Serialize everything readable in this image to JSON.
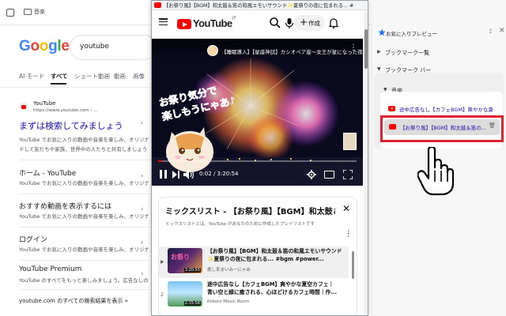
{
  "google": {
    "topbar_label": "音楽",
    "search_value": "youtube",
    "tabs": [
      "AI モード",
      "すべて",
      "ショート動画",
      "動画",
      "画像"
    ],
    "result": {
      "site_name": "YouTube",
      "url": "https://www.youtube.com › ...",
      "title": "まずは検索してみましょう",
      "snippet1": "YouTube でお気に入りの動画や音楽を楽しみ、オリジナ",
      "snippet2": "ドして友だちや家族、世界中の人たちと共有しましょう"
    },
    "subresults": [
      {
        "title": "ホーム - YouTube",
        "snippet": "YouTube でお気に入りの動画や音楽を楽しみ、オリジナ"
      },
      {
        "title": "おすすめ動画を表示するには",
        "snippet": "YouTube でお気に入りの動画や音楽を楽しみ、オリジナ"
      },
      {
        "title": "ログイン",
        "snippet": "YouTube でお気に入りの動画や音楽を楽しみ、オリジナ"
      },
      {
        "title": "YouTube Premium",
        "snippet": "YouTube のすべてをもっと楽しみましょう。広告なしの"
      }
    ],
    "more_results": "youtube.com のすべての検索結果を表示 »"
  },
  "youtube": {
    "window_title": "【お祭り風】【BGM】和太鼓＆笛の和風エモいサウンド✨夏祭りの夜に包まれる... #b...",
    "logo_word": "YouTube",
    "logo_region": "JP",
    "create_label": "作成",
    "video": {
      "overlay_title": "【睡眠導入】【星座神話】カシオペア座〜女王が星になった夜...",
      "pink_text_1": "お祭り気分で",
      "pink_text_2": "楽しもうにゃあ♪",
      "time": "0:02 / 3:20:54",
      "progress": 0.02
    },
    "playlist": {
      "title": "ミックスリスト - 【お祭り風】【BGM】和太鼓＆笛の和風...",
      "description": "ミックスリストとは、YouTube があなたのために作成したプレイリストです",
      "items": [
        {
          "marker": "▶",
          "line1": "【お祭り風】【BGM】和太鼓＆笛の和風エモいサウンド",
          "line2": "✨夏祭りの夜に包まれる... #bgm #power...",
          "channel": "癒し系まいみーにゃあ",
          "duration": "3:20:55",
          "thumb_text": "お祭り"
        },
        {
          "marker": "2",
          "line1": "途中広告なし【カフェBGM】爽やかな夏空カフェ｜",
          "line2": "青い空と緑に癒される、心ほどけるカフェ時間｜作...",
          "channel": "Kokoro Music Room",
          "duration": "2:15:56",
          "thumb_text": ""
        }
      ]
    }
  },
  "bookmarks": {
    "panel_title": "お気に入りプレビュー",
    "root": "ブックマーク一覧",
    "bar": "ブックマーク バー",
    "folder": "音楽",
    "items": [
      "途中広告なし【カフェBGM】爽やかな夏...",
      "【お祭り風】【BGM】和太鼓＆笛の..."
    ]
  },
  "colors": {
    "youtube_red": "#ff0000",
    "google_link": "#1a0dab",
    "highlight_red": "#e0222f",
    "pink_text": "#ff5fa8"
  },
  "icons": [
    "search-icon",
    "mic-icon",
    "bell-icon",
    "menu-icon",
    "pause-icon",
    "next-icon",
    "volume-icon",
    "gear-icon",
    "miniplayer-icon",
    "fullscreen-icon",
    "close-icon",
    "pin-icon",
    "star-icon",
    "trash-icon",
    "hand-cursor-icon"
  ]
}
